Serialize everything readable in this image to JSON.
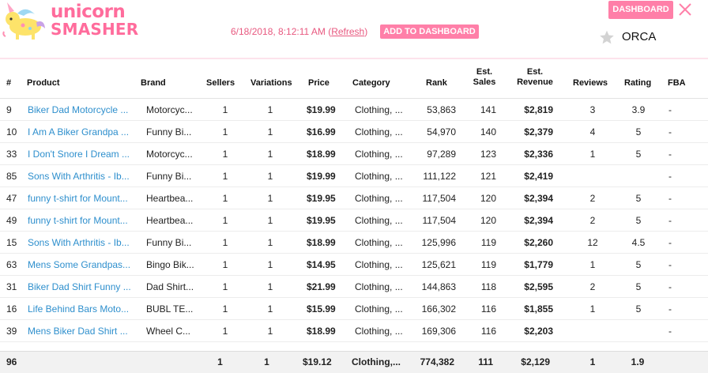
{
  "app": {
    "brand_line1": "unicorn",
    "brand_line2": "SMASHER",
    "timestamp": "6/18/2018, 8:12:11 AM (",
    "refresh_label": "Refresh",
    "timestamp_end": ")",
    "add_dashboard_label": "ADD TO DASHBOARD",
    "dashboard_label": "DASHBOARD",
    "user_label": "ORCA",
    "accent_color": "#ff7fa8",
    "link_color": "#2e8fcd"
  },
  "table": {
    "headers": {
      "num": "#",
      "product": "Product",
      "brand": "Brand",
      "sellers": "Sellers",
      "variations": "Variations",
      "price": "Price",
      "category": "Category",
      "rank": "Rank",
      "sales_l1": "Est.",
      "sales_l2": "Sales",
      "revenue_l1": "Est.",
      "revenue_l2": "Revenue",
      "reviews": "Reviews",
      "rating": "Rating",
      "fba": "FBA"
    },
    "rows": [
      {
        "num": "9",
        "product": "Biker Dad Motorcycle ...",
        "brand": "Motorcyc...",
        "sellers": "1",
        "variations": "1",
        "price": "$19.99",
        "category": "Clothing, ...",
        "rank": "53,863",
        "sales": "141",
        "revenue": "$2,819",
        "reviews": "3",
        "rating": "3.9",
        "fba": "-"
      },
      {
        "num": "10",
        "product": "I Am A Biker Grandpa ...",
        "brand": "Funny Bi...",
        "sellers": "1",
        "variations": "1",
        "price": "$16.99",
        "category": "Clothing, ...",
        "rank": "54,970",
        "sales": "140",
        "revenue": "$2,379",
        "reviews": "4",
        "rating": "5",
        "fba": "-"
      },
      {
        "num": "33",
        "product": "I Don't Snore I Dream ...",
        "brand": "Motorcyc...",
        "sellers": "1",
        "variations": "1",
        "price": "$18.99",
        "category": "Clothing, ...",
        "rank": "97,289",
        "sales": "123",
        "revenue": "$2,336",
        "reviews": "1",
        "rating": "5",
        "fba": "-"
      },
      {
        "num": "85",
        "product": "Sons With Arthritis - Ib...",
        "brand": "Funny Bi...",
        "sellers": "1",
        "variations": "1",
        "price": "$19.99",
        "category": "Clothing, ...",
        "rank": "111,122",
        "sales": "121",
        "revenue": "$2,419",
        "reviews": "",
        "rating": "",
        "fba": "-"
      },
      {
        "num": "47",
        "product": "funny t-shirt for Mount...",
        "brand": "Heartbea...",
        "sellers": "1",
        "variations": "1",
        "price": "$19.95",
        "category": "Clothing, ...",
        "rank": "117,504",
        "sales": "120",
        "revenue": "$2,394",
        "reviews": "2",
        "rating": "5",
        "fba": "-"
      },
      {
        "num": "49",
        "product": "funny t-shirt for Mount...",
        "brand": "Heartbea...",
        "sellers": "1",
        "variations": "1",
        "price": "$19.95",
        "category": "Clothing, ...",
        "rank": "117,504",
        "sales": "120",
        "revenue": "$2,394",
        "reviews": "2",
        "rating": "5",
        "fba": "-"
      },
      {
        "num": "15",
        "product": "Sons With Arthritis - Ib...",
        "brand": "Funny Bi...",
        "sellers": "1",
        "variations": "1",
        "price": "$18.99",
        "category": "Clothing, ...",
        "rank": "125,996",
        "sales": "119",
        "revenue": "$2,260",
        "reviews": "12",
        "rating": "4.5",
        "fba": "-"
      },
      {
        "num": "63",
        "product": "Mens Some Grandpas...",
        "brand": "Bingo Bik...",
        "sellers": "1",
        "variations": "1",
        "price": "$14.95",
        "category": "Clothing, ...",
        "rank": "125,621",
        "sales": "119",
        "revenue": "$1,779",
        "reviews": "1",
        "rating": "5",
        "fba": "-"
      },
      {
        "num": "31",
        "product": "Biker Dad Shirt Funny ...",
        "brand": "Dad Shirt...",
        "sellers": "1",
        "variations": "1",
        "price": "$21.99",
        "category": "Clothing, ...",
        "rank": "144,863",
        "sales": "118",
        "revenue": "$2,595",
        "reviews": "2",
        "rating": "5",
        "fba": "-"
      },
      {
        "num": "16",
        "product": "Life Behind Bars Moto...",
        "brand": "BUBL TE...",
        "sellers": "1",
        "variations": "1",
        "price": "$15.99",
        "category": "Clothing, ...",
        "rank": "166,302",
        "sales": "116",
        "revenue": "$1,855",
        "reviews": "1",
        "rating": "5",
        "fba": "-"
      },
      {
        "num": "39",
        "product": "Mens Biker Dad Shirt ...",
        "brand": "Wheel C...",
        "sellers": "1",
        "variations": "1",
        "price": "$18.99",
        "category": "Clothing, ...",
        "rank": "169,306",
        "sales": "116",
        "revenue": "$2,203",
        "reviews": "",
        "rating": "",
        "fba": "-"
      }
    ],
    "footer": {
      "num": "96",
      "sellers": "1",
      "variations": "1",
      "price": "$19.12",
      "category": "Clothing,...",
      "rank": "774,382",
      "sales": "111",
      "revenue": "$2,129",
      "reviews": "1",
      "rating": "1.9"
    }
  }
}
